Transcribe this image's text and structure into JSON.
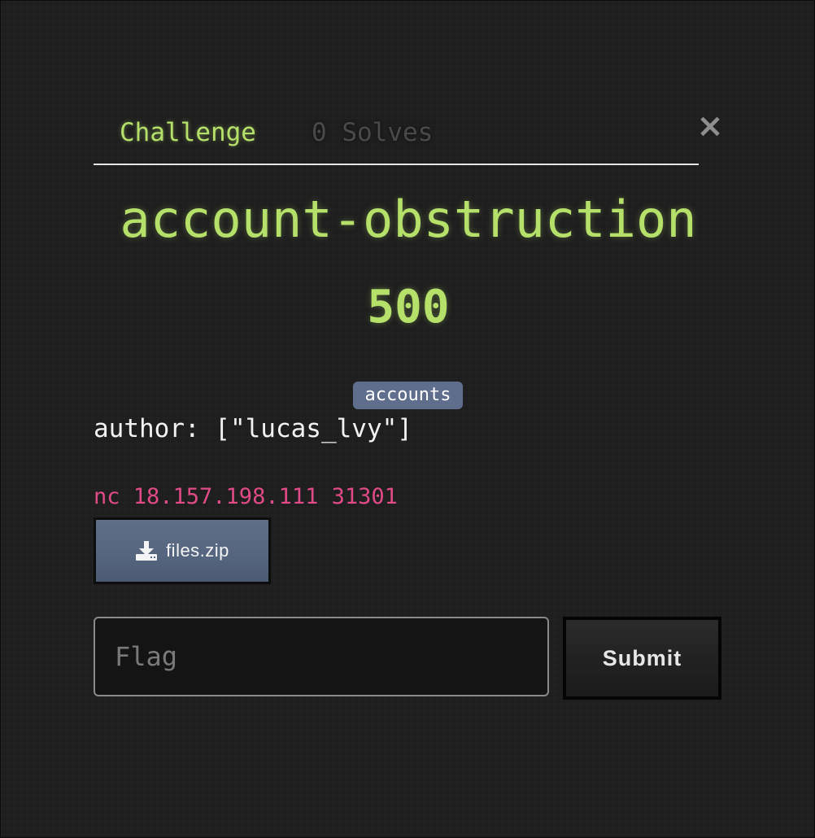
{
  "tabs": {
    "challenge_label": "Challenge",
    "solves_label": "0 Solves"
  },
  "close_label": "×",
  "challenge": {
    "name": "account-obstruction",
    "value": "500",
    "tag": "accounts",
    "author_text": "author: [\"lucas_lvy\"]",
    "connection": "nc 18.157.198.111 31301",
    "file_label": "files.zip",
    "file_icon": "download-icon"
  },
  "form": {
    "flag_placeholder": "Flag",
    "flag_value": "",
    "submit_label": "Submit"
  },
  "colors": {
    "accent_green": "#b5e06a",
    "connection_pink": "#e04a86",
    "tag_bg": "#5f6e8c",
    "file_button_bg": "#566680"
  }
}
